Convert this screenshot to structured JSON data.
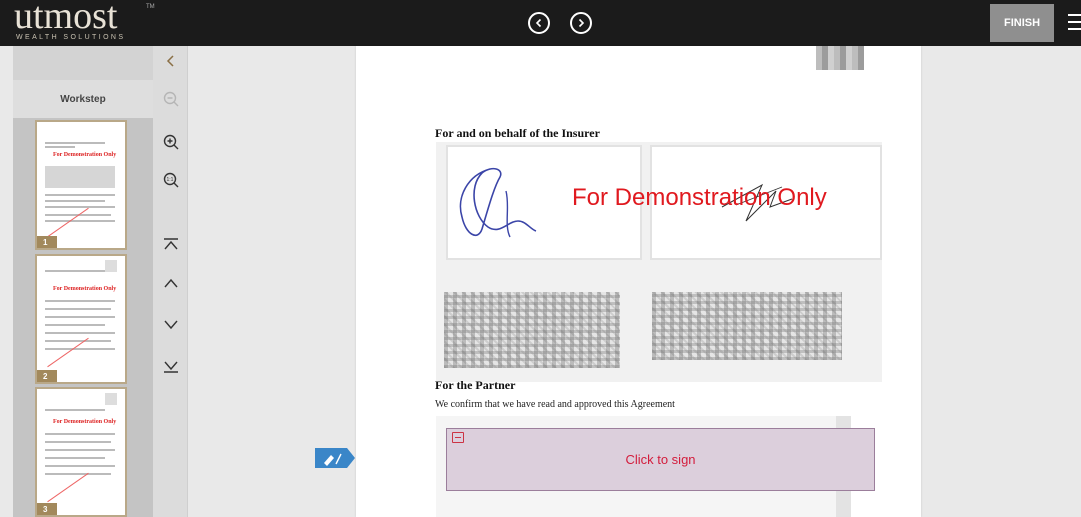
{
  "header": {
    "logo_word": "utmost",
    "logo_sub": "WEALTH SOLUTIONS",
    "logo_tm": "TM",
    "prev_icon": "chevron-left-circle-icon",
    "next_icon": "chevron-right-circle-icon",
    "finish_label": "FINISH",
    "menu_icon": "hamburger-menu-icon"
  },
  "sidebar": {
    "collapse_icon": "chevron-left-icon",
    "title": "Workstep",
    "thumbnails": [
      {
        "page": "1",
        "demo": "For Demonstration Only"
      },
      {
        "page": "2",
        "demo": "For Demonstration Only"
      },
      {
        "page": "3",
        "demo": "For Demonstration Only"
      }
    ]
  },
  "tools": [
    "zoom-out-icon",
    "zoom-in-icon",
    "zoom-fit-icon",
    "first-page-icon",
    "previous-page-icon",
    "next-page-icon",
    "last-page-icon"
  ],
  "document": {
    "insurer_heading": "For and on behalf of the Insurer",
    "demo_stamp": "For Demonstration Only",
    "partner_heading": "For the Partner",
    "partner_text": "We confirm that we have read and approved this Agreement",
    "click_to_sign": "Click to sign"
  },
  "colors": {
    "topbar": "#1b1b1b",
    "accent_gold": "#a2895c",
    "demo_red": "#e0191f",
    "sign_field": "#dccfdc",
    "pen_tag": "#3a86c8"
  }
}
